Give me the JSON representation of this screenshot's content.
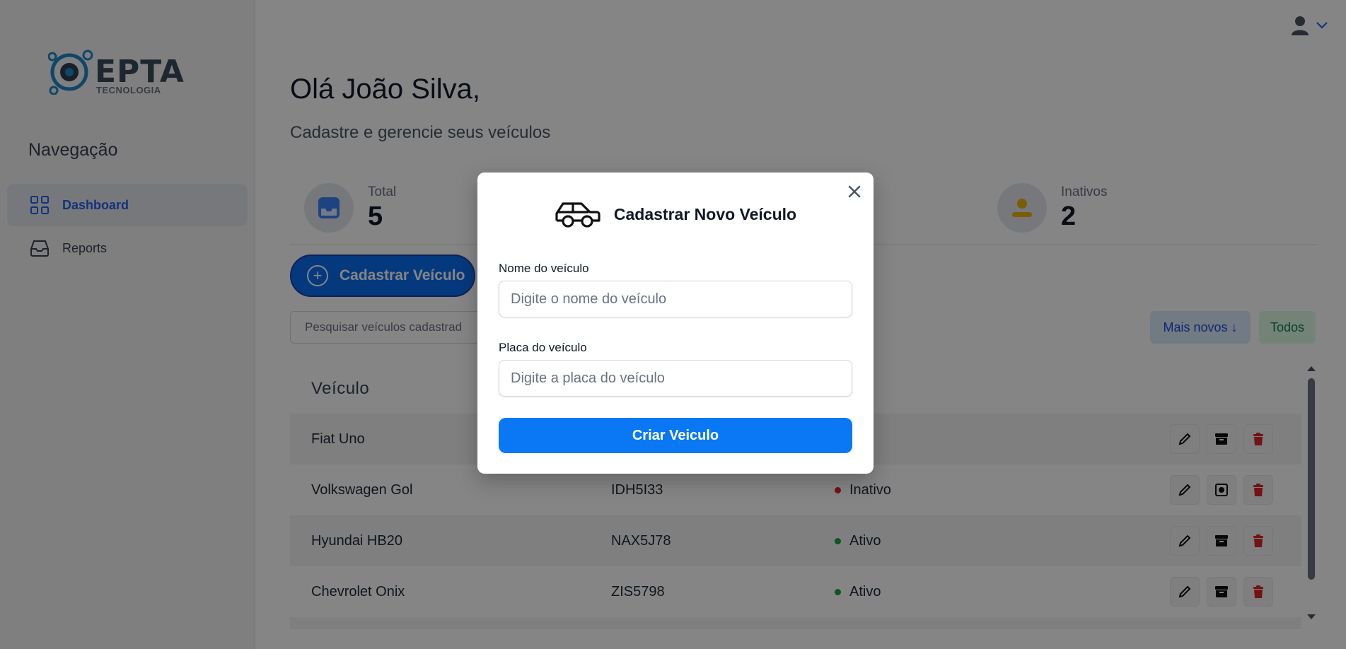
{
  "brand": {
    "logo_text": "EPTA",
    "logo_sub": "TECNOLOGIA"
  },
  "sidebar": {
    "title": "Navegação",
    "items": [
      {
        "label": "Dashboard",
        "active": true
      },
      {
        "label": "Reports",
        "active": false
      }
    ]
  },
  "header": {
    "greeting": "Olá João Silva,",
    "subtitle": "Cadastre e gerencie seus veículos"
  },
  "stats": [
    {
      "label": "Total",
      "value": "5"
    },
    {
      "label": "Inativos",
      "value": "2"
    }
  ],
  "actions": {
    "new_vehicle_label": "Cadastrar Veículo",
    "search_placeholder": "Pesquisar veículos cadastrad",
    "sort_label": "Mais novos ↓",
    "filter_label": "Todos"
  },
  "table": {
    "columns": [
      "Veículo",
      "",
      "s"
    ],
    "rows": [
      {
        "name": "Fiat Uno",
        "plate": "",
        "status": "o",
        "status_color": "#16a34a"
      },
      {
        "name": "Volkswagen Gol",
        "plate": "IDH5I33",
        "status": "Inativo",
        "status_color": "#dc2626"
      },
      {
        "name": "Hyundai HB20",
        "plate": "NAX5J78",
        "status": "Ativo",
        "status_color": "#16a34a"
      },
      {
        "name": "Chevrolet Onix",
        "plate": "ZIS5798",
        "status": "Ativo",
        "status_color": "#16a34a"
      }
    ]
  },
  "modal": {
    "title": "Cadastrar Novo Veículo",
    "name_label": "Nome do veículo",
    "name_placeholder": "Digite o nome do veículo",
    "plate_label": "Placa do veículo",
    "plate_placeholder": "Digite a placa do veículo",
    "submit_label": "Criar Veiculo"
  },
  "colors": {
    "primary": "#0a78f5",
    "active_nav": "#2563eb",
    "danger": "#dc2626",
    "success": "#16a34a"
  }
}
